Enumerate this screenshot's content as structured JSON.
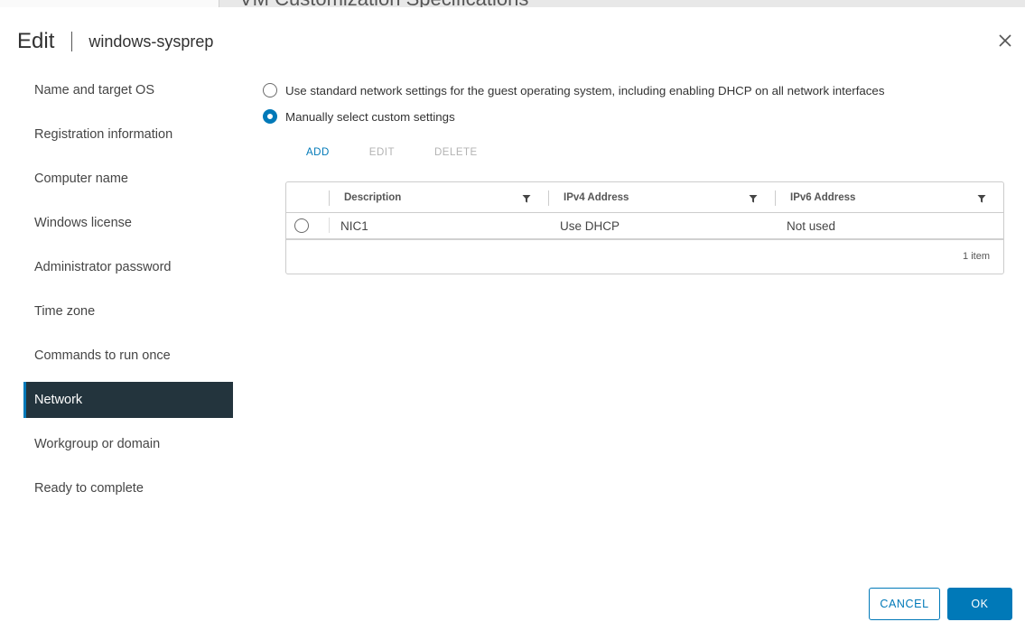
{
  "background": {
    "page_title": "VM Customization Specifications"
  },
  "header": {
    "title": "Edit",
    "spec_name": "windows-sysprep"
  },
  "sidebar": {
    "items": [
      {
        "label": "Name and target OS"
      },
      {
        "label": "Registration information"
      },
      {
        "label": "Computer name"
      },
      {
        "label": "Windows license"
      },
      {
        "label": "Administrator password"
      },
      {
        "label": "Time zone"
      },
      {
        "label": "Commands to run once"
      },
      {
        "label": "Network",
        "active": true
      },
      {
        "label": "Workgroup or domain"
      },
      {
        "label": "Ready to complete"
      }
    ]
  },
  "network": {
    "option_standard": "Use standard network settings for the guest operating system, including enabling DHCP on all network interfaces",
    "option_custom": "Manually select custom settings",
    "selected_option": "custom",
    "toolbar": {
      "add": "ADD",
      "edit": "EDIT",
      "delete": "DELETE"
    },
    "grid": {
      "columns": [
        "Description",
        "IPv4 Address",
        "IPv6 Address"
      ],
      "rows": [
        {
          "description": "NIC1",
          "ipv4": "Use DHCP",
          "ipv6": "Not used"
        }
      ],
      "footer": "1 item"
    }
  },
  "buttons": {
    "cancel": "CANCEL",
    "ok": "OK"
  },
  "colors": {
    "accent": "#0079b8",
    "nav_active_bg": "#23343d"
  },
  "icons": {
    "close": "close-icon",
    "filter": "filter-icon"
  }
}
